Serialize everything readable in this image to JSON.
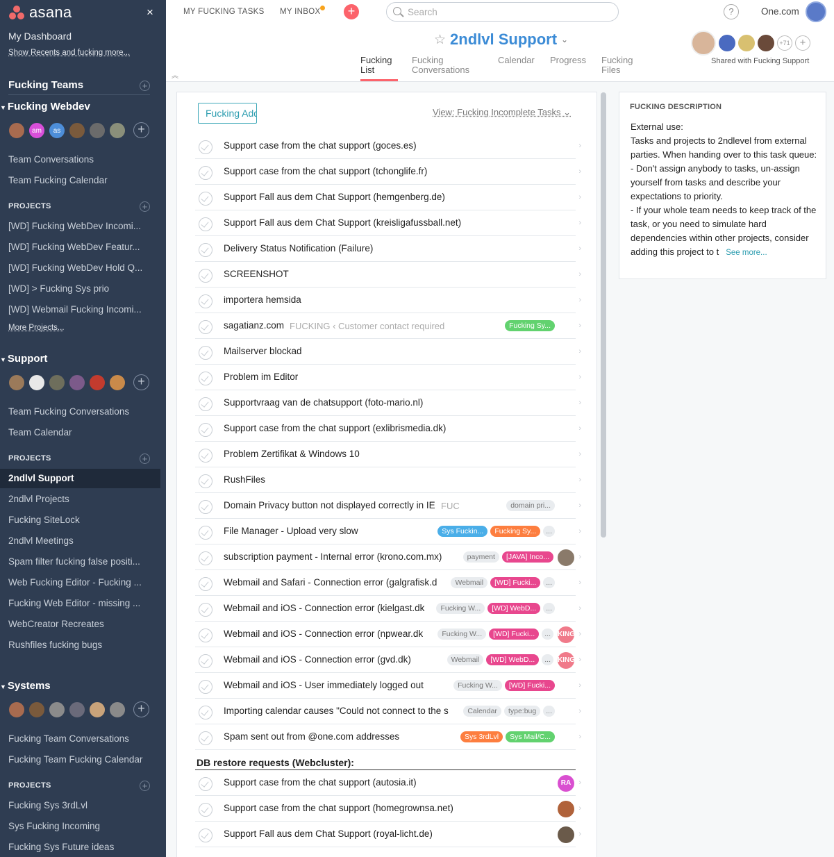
{
  "sidebar": {
    "logo": "asana",
    "close": "×",
    "dashboard": "My Dashboard",
    "recents": "Show Recents and fucking more...",
    "teams_header": "Fucking Teams",
    "teams": [
      {
        "name": "Fucking Webdev",
        "members": [
          {
            "initials": "",
            "color": "#a86b4f"
          },
          {
            "initials": "am",
            "color": "#d84fd9"
          },
          {
            "initials": "as",
            "color": "#4d8ed9"
          },
          {
            "initials": "",
            "color": "#7a5a3c"
          },
          {
            "initials": "",
            "color": "#6b6b6b"
          },
          {
            "initials": "",
            "color": "#8a8f7a"
          }
        ],
        "links": [
          "Team Conversations",
          "Team Fucking Calendar"
        ],
        "projects_label": "PROJECTS",
        "projects": [
          "[WD] Fucking WebDev Incomi...",
          "[WD] Fucking WebDev Featur...",
          "[WD] Fucking WebDev Hold Q...",
          "[WD] > Fucking Sys prio",
          "[WD] Webmail Fucking Incomi..."
        ],
        "more_projects": "More Projects..."
      },
      {
        "name": "Support",
        "members": [
          {
            "initials": "",
            "color": "#9b7a5a"
          },
          {
            "initials": "",
            "color": "#e8e8e8"
          },
          {
            "initials": "",
            "color": "#6e6e5c"
          },
          {
            "initials": "",
            "color": "#7c5a8a"
          },
          {
            "initials": "",
            "color": "#c23b2e"
          },
          {
            "initials": "",
            "color": "#c98a4a"
          }
        ],
        "links": [
          "Team Fucking Conversations",
          "Team Calendar"
        ],
        "projects_label": "PROJECTS",
        "projects": [
          "2ndlvl Support",
          "2ndlvl Projects",
          "Fucking SiteLock",
          "2ndlvl Meetings",
          "Spam filter fucking false positi...",
          "Web Fucking Editor - Fucking ...",
          "Fucking Web Editor - missing ...",
          "WebCreator Recreates",
          "Rushfiles fucking bugs"
        ],
        "active_project": "2ndlvl Support"
      },
      {
        "name": "Systems",
        "members": [
          {
            "initials": "",
            "color": "#a86b4f"
          },
          {
            "initials": "",
            "color": "#7a5a3c"
          },
          {
            "initials": "",
            "color": "#8b8b8b"
          },
          {
            "initials": "",
            "color": "#6a6a7a"
          },
          {
            "initials": "",
            "color": "#c9a37a"
          },
          {
            "initials": "",
            "color": "#8a8a8a"
          }
        ],
        "links": [
          "Fucking Team Conversations",
          "Fucking Team Fucking Calendar"
        ],
        "projects_label": "PROJECTS",
        "projects": [
          "Fucking Sys 3rdLvl",
          "Sys Fucking Incoming",
          "Fucking Sys Future ideas"
        ]
      }
    ]
  },
  "topbar": {
    "my_tasks": "MY FUCKING TASKS",
    "my_inbox": "MY INBOX",
    "add": "+",
    "search_placeholder": "Search",
    "help": "?",
    "org": "One.com"
  },
  "project": {
    "title": "2ndlvl Support",
    "star": "☆",
    "chevron": "⌄",
    "tabs": [
      {
        "line1": "Fucking",
        "line2": "List"
      },
      {
        "line1": "Fucking",
        "line2": "Conversations"
      },
      {
        "line1": "Calendar",
        "line2": ""
      },
      {
        "line1": "Progress",
        "line2": ""
      },
      {
        "line1": "Fucking",
        "line2": "Files"
      }
    ],
    "members_more": "+71",
    "shared_with": "Shared with Fucking Support"
  },
  "list": {
    "add_button": "Fucking Add",
    "view": "View: Fucking Incomplete Tasks ⌄",
    "tasks": [
      {
        "name": "Support case from the chat support (goces.es)"
      },
      {
        "name": "Support case from the chat support (tchonglife.fr)"
      },
      {
        "name": "Support Fall aus dem Chat Support (hemgenberg.de)"
      },
      {
        "name": "Support Fall aus dem Chat Support (kreisligafussball.net)"
      },
      {
        "name": "Delivery Status Notification (Failure)"
      },
      {
        "name": "SCREENSHOT"
      },
      {
        "name": "importera hemsida"
      },
      {
        "name": "sagatianz.com",
        "meta": "FUCKING ‹ Customer contact required",
        "tags": [
          {
            "t": "Fucking Sy...",
            "c": "green"
          }
        ]
      },
      {
        "name": "Mailserver blockad"
      },
      {
        "name": "Problem im Editor"
      },
      {
        "name": "Supportvraag van de chatsupport (foto-mario.nl)"
      },
      {
        "name": "Support case from the chat support (exlibrismedia.dk)"
      },
      {
        "name": "Problem Zertifikat & Windows 10"
      },
      {
        "name": "RushFiles"
      },
      {
        "name": "Domain Privacy button not displayed correctly in IE",
        "meta": "FUC",
        "tags": [
          {
            "t": "domain pri...",
            "c": "grey"
          }
        ]
      },
      {
        "name": "File Manager - Upload very slow",
        "tags": [
          {
            "t": "Sys Fuckin...",
            "c": "blue"
          },
          {
            "t": "Fucking Sy...",
            "c": "orange"
          },
          {
            "t": "...",
            "c": "ell"
          }
        ]
      },
      {
        "name": "subscription payment - Internal error (krono.com.mx)",
        "tags": [
          {
            "t": "payment",
            "c": "grey"
          },
          {
            "t": "[JAVA] Inco...",
            "c": "pink"
          }
        ],
        "avatar": {
          "initials": "",
          "color": "#8a7a6a"
        }
      },
      {
        "name": "Webmail and Safari - Connection error (galgrafisk.d",
        "tags": [
          {
            "t": "Webmail",
            "c": "grey"
          },
          {
            "t": "[WD] Fucki...",
            "c": "pink"
          },
          {
            "t": "...",
            "c": "ell"
          }
        ]
      },
      {
        "name": "Webmail and iOS - Connection error (kielgast.dk",
        "tags": [
          {
            "t": "Fucking W...",
            "c": "grey"
          },
          {
            "t": "[WD] WebD...",
            "c": "pink"
          },
          {
            "t": "...",
            "c": "ell"
          }
        ]
      },
      {
        "name": "Webmail and iOS - Connection error (npwear.dk",
        "tags": [
          {
            "t": "Fucking W...",
            "c": "grey"
          },
          {
            "t": "[WD] Fucki...",
            "c": "pink"
          },
          {
            "t": "...",
            "c": "ell"
          }
        ],
        "avatar": {
          "initials": "KING",
          "color": "#f07a8a"
        }
      },
      {
        "name": "Webmail and iOS - Connection error (gvd.dk)",
        "tags": [
          {
            "t": "Webmail",
            "c": "grey"
          },
          {
            "t": "[WD] WebD...",
            "c": "pink"
          },
          {
            "t": "...",
            "c": "ell"
          }
        ],
        "avatar": {
          "initials": "KING",
          "color": "#f07a8a"
        }
      },
      {
        "name": "Webmail and iOS - User immediately logged out",
        "tags": [
          {
            "t": "Fucking W...",
            "c": "grey"
          },
          {
            "t": "[WD] Fucki...",
            "c": "pink"
          }
        ]
      },
      {
        "name": "Importing calendar causes \"Could not connect to the s",
        "tags": [
          {
            "t": "Calendar",
            "c": "grey"
          },
          {
            "t": "type:bug",
            "c": "grey"
          },
          {
            "t": "...",
            "c": "ell"
          }
        ]
      },
      {
        "name": "Spam sent out from @one.com addresses",
        "tags": [
          {
            "t": "Sys 3rdLvl",
            "c": "orange"
          },
          {
            "t": "Sys Mail/C...",
            "c": "green"
          }
        ]
      }
    ],
    "section": "DB restore requests (Webcluster):",
    "section_tasks": [
      {
        "name": "Support case from the chat support (autosia.it)",
        "avatar": {
          "initials": "RA",
          "color": "#d94fd0"
        }
      },
      {
        "name": "Support case from the chat support (homegrownsa.net)",
        "avatar": {
          "initials": "",
          "color": "#b0623a"
        }
      },
      {
        "name": "Support Fall aus dem Chat Support (royal-licht.de)",
        "avatar": {
          "initials": "",
          "color": "#6a5a4a"
        }
      }
    ]
  },
  "description": {
    "header": "FUCKING DESCRIPTION",
    "lines": [
      "External use:",
      "Tasks and projects to 2ndlevel from external parties. When handing over to this task queue:",
      "- Don't assign anybody to tasks, un-assign yourself from tasks and describe your expectations to priority.",
      "- If your whole team needs to keep track of the task, or you need to simulate hard dependencies within other projects, consider adding this project to t"
    ],
    "see_more": "See more..."
  }
}
